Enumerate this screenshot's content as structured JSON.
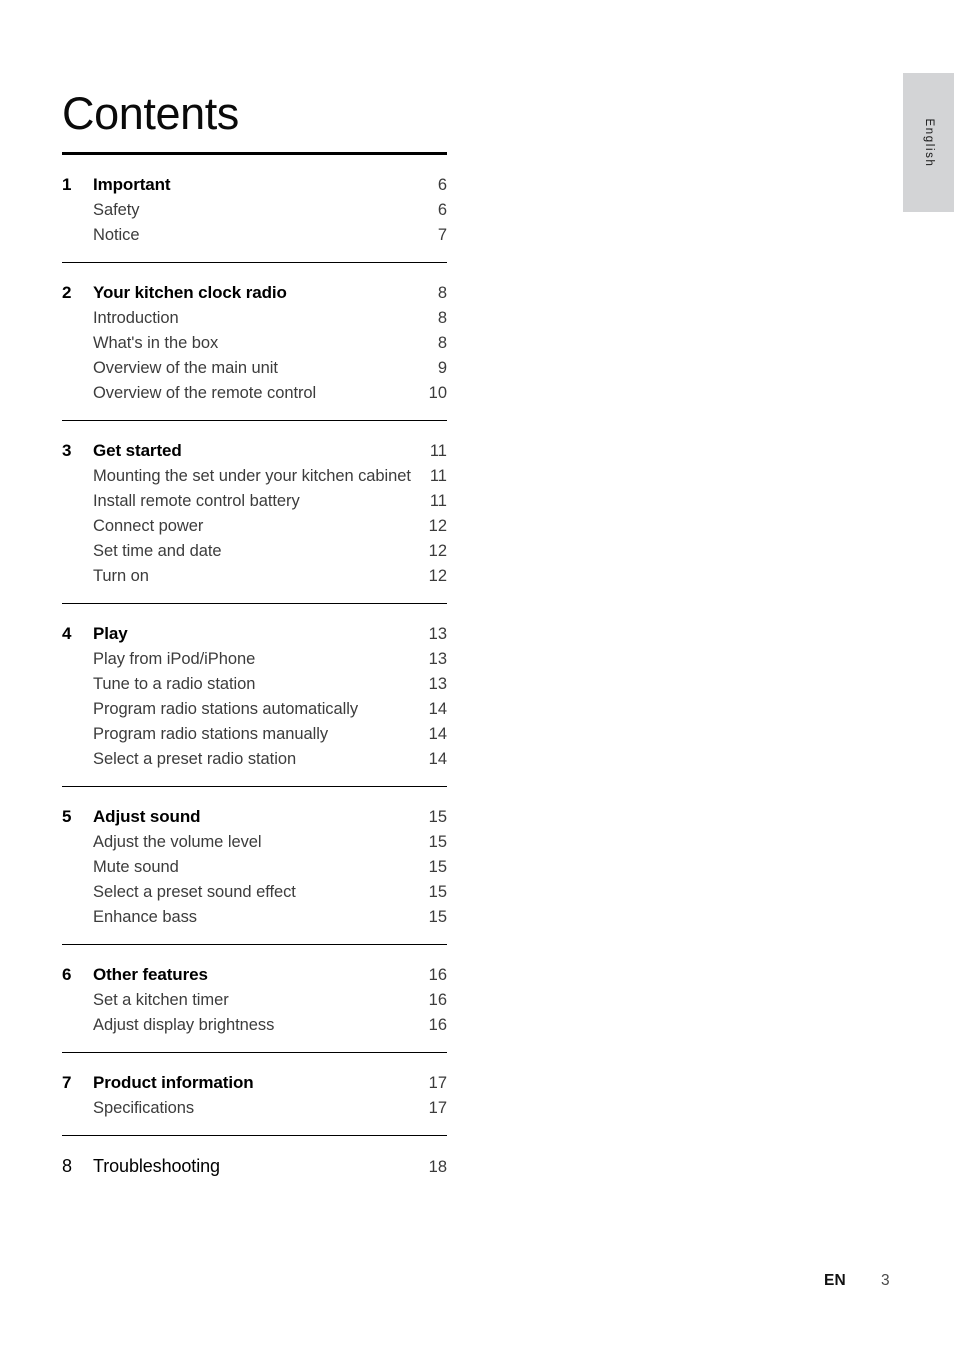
{
  "page_title": "Contents",
  "side_tab": {
    "label": "English"
  },
  "footer": {
    "locale": "EN",
    "page_number": "3"
  },
  "toc": {
    "sections": [
      {
        "number": "1",
        "title": "Important",
        "page": "6",
        "rule": "thick",
        "items": [
          {
            "label": "Safety",
            "page": "6"
          },
          {
            "label": "Notice",
            "page": "7"
          }
        ]
      },
      {
        "number": "2",
        "title": "Your kitchen clock radio",
        "page": "8",
        "rule": "thin",
        "items": [
          {
            "label": "Introduction",
            "page": "8"
          },
          {
            "label": "What's in the box",
            "page": "8"
          },
          {
            "label": "Overview of the main unit",
            "page": "9"
          },
          {
            "label": "Overview of the remote control",
            "page": "10"
          }
        ]
      },
      {
        "number": "3",
        "title": "Get started",
        "page": "11",
        "rule": "thin",
        "items": [
          {
            "label": "Mounting the set under your kitchen cabinet",
            "page": "11",
            "wrap": true
          },
          {
            "label": "Install remote control battery",
            "page": "11"
          },
          {
            "label": "Connect power",
            "page": "12"
          },
          {
            "label": "Set time and date",
            "page": "12"
          },
          {
            "label": "Turn on",
            "page": "12"
          }
        ]
      },
      {
        "number": "4",
        "title": "Play",
        "page": "13",
        "rule": "thin",
        "items": [
          {
            "label": "Play from iPod/iPhone",
            "page": "13"
          },
          {
            "label": "Tune to a radio station",
            "page": "13"
          },
          {
            "label": "Program radio stations automatically",
            "page": "14"
          },
          {
            "label": "Program radio stations manually",
            "page": "14"
          },
          {
            "label": "Select a preset radio station",
            "page": "14"
          }
        ]
      },
      {
        "number": "5",
        "title": "Adjust sound",
        "page": "15",
        "rule": "thin",
        "items": [
          {
            "label": "Adjust the volume level",
            "page": "15"
          },
          {
            "label": "Mute sound",
            "page": "15"
          },
          {
            "label": "Select a preset sound effect",
            "page": "15"
          },
          {
            "label": "Enhance bass",
            "page": "15"
          }
        ]
      },
      {
        "number": "6",
        "title": "Other features",
        "page": "16",
        "rule": "thin",
        "items": [
          {
            "label": "Set a kitchen timer",
            "page": "16"
          },
          {
            "label": "Adjust display brightness",
            "page": "16"
          }
        ]
      },
      {
        "number": "7",
        "title": "Product information",
        "page": "17",
        "rule": "thin",
        "items": [
          {
            "label": "Specifications",
            "page": "17"
          }
        ]
      },
      {
        "number": "8",
        "title": "Troubleshooting",
        "page": "18",
        "rule": "thin",
        "light": true,
        "items": []
      }
    ]
  }
}
